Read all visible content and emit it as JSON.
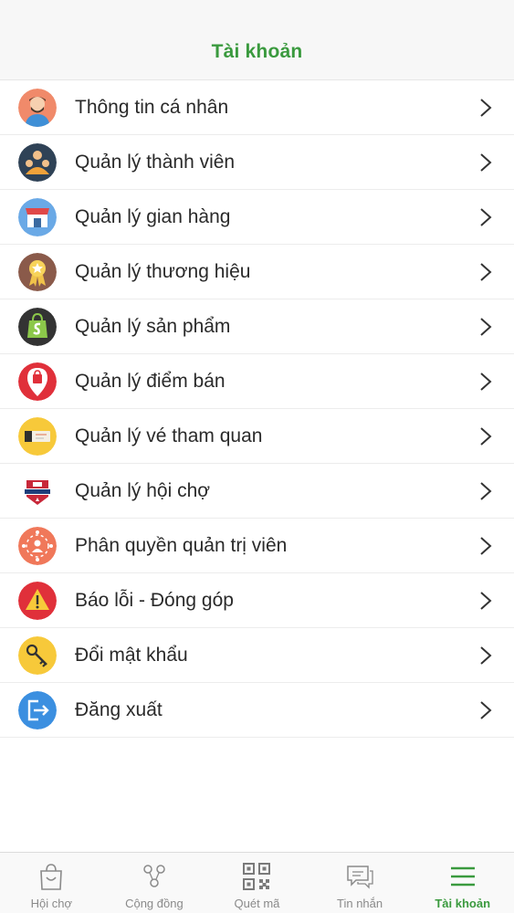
{
  "header": {
    "title": "Tài khoản"
  },
  "menu": {
    "items": [
      {
        "label": "Thông tin cá nhân",
        "icon": "user-profile-icon"
      },
      {
        "label": "Quản lý thành viên",
        "icon": "members-icon"
      },
      {
        "label": "Quản lý gian hàng",
        "icon": "store-icon"
      },
      {
        "label": "Quản lý thương hiệu",
        "icon": "brand-badge-icon"
      },
      {
        "label": "Quản lý sản phẩm",
        "icon": "shopping-bag-icon"
      },
      {
        "label": "Quản lý điểm bán",
        "icon": "location-pin-icon"
      },
      {
        "label": "Quản lý vé tham quan",
        "icon": "ticket-icon"
      },
      {
        "label": "Quản lý hội chợ",
        "icon": "fair-badge-icon"
      },
      {
        "label": "Phân quyền quản trị viên",
        "icon": "admin-permission-icon"
      },
      {
        "label": "Báo lỗi - Đóng góp",
        "icon": "warning-icon"
      },
      {
        "label": "Đổi mật khẩu",
        "icon": "key-icon"
      },
      {
        "label": "Đăng xuất",
        "icon": "logout-icon"
      }
    ]
  },
  "tabbar": {
    "tabs": [
      {
        "label": "Hội chợ",
        "icon": "shopping-bag-tab-icon",
        "active": false
      },
      {
        "label": "Cộng đồng",
        "icon": "community-icon",
        "active": false
      },
      {
        "label": "Quét mã",
        "icon": "qr-code-icon",
        "active": false
      },
      {
        "label": "Tin nhắn",
        "icon": "chat-icon",
        "active": false
      },
      {
        "label": "Tài khoản",
        "icon": "hamburger-menu-icon",
        "active": true
      }
    ]
  },
  "colors": {
    "accent": "#3a9a3e",
    "inactive": "#8a8a8a"
  }
}
